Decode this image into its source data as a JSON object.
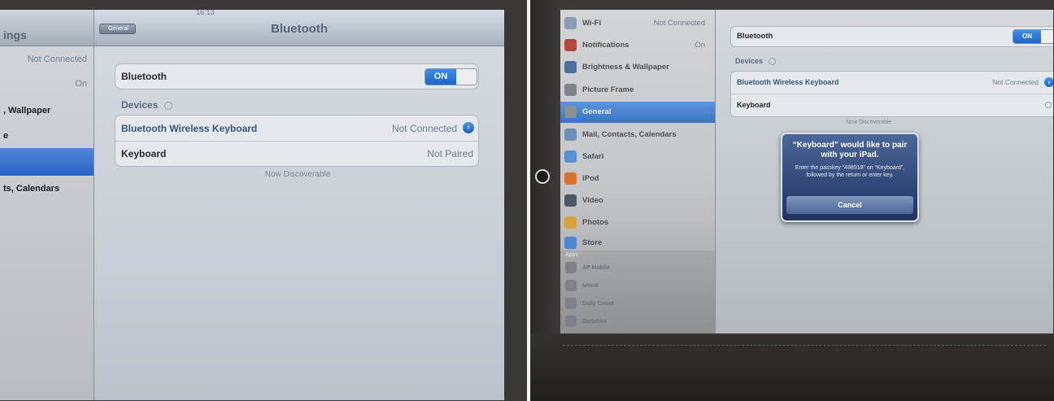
{
  "left_photo": {
    "status_bar": {
      "time": "16:13"
    },
    "sidebar": {
      "title": "ings",
      "items": [
        {
          "label": "",
          "value": "Not Connected"
        },
        {
          "label": "",
          "value": "On"
        },
        {
          "label": ", Wallpaper",
          "value": ""
        },
        {
          "label": "e",
          "value": ""
        },
        {
          "label": "",
          "value": "",
          "selected": true
        },
        {
          "label": "ts, Calendars",
          "value": ""
        }
      ]
    },
    "navbar": {
      "back_label": "General",
      "title": "Bluetooth"
    },
    "bluetooth": {
      "label": "Bluetooth",
      "toggle": "ON"
    },
    "devices_header": "Devices",
    "devices": [
      {
        "name": "Bluetooth Wireless Keyboard",
        "status": "Not Connected"
      },
      {
        "name": "Keyboard",
        "status": "Not Paired"
      }
    ],
    "discoverable": "Now Discoverable"
  },
  "right_photo": {
    "sidebar": {
      "items": [
        {
          "label": "Wi-Fi",
          "value": "Not Connected",
          "icon": "wifi-icon",
          "color": "#8a9cb4"
        },
        {
          "label": "Notifications",
          "value": "On",
          "icon": "notifications-icon",
          "color": "#b5473c"
        },
        {
          "label": "Brightness & Wallpaper",
          "value": "",
          "icon": "brightness-icon",
          "color": "#4d6e9b"
        },
        {
          "label": "Picture Frame",
          "value": "",
          "icon": "picture-frame-icon",
          "color": "#7e848c"
        },
        {
          "label": "General",
          "value": "",
          "icon": "gear-icon",
          "color": "#8b9096",
          "selected": true
        },
        {
          "label": "Mail, Contacts, Calendars",
          "value": "",
          "icon": "mail-icon",
          "color": "#6f8fb8"
        },
        {
          "label": "Safari",
          "value": "",
          "icon": "safari-icon",
          "color": "#5a8fd1"
        },
        {
          "label": "iPod",
          "value": "",
          "icon": "ipod-icon",
          "color": "#d9722c"
        },
        {
          "label": "Video",
          "value": "",
          "icon": "video-icon",
          "color": "#4e5865"
        },
        {
          "label": "Photos",
          "value": "",
          "icon": "photos-icon",
          "color": "#d9a33a"
        },
        {
          "label": "Store",
          "value": "",
          "icon": "store-icon",
          "color": "#4f86cf"
        }
      ],
      "apps_header": "Apps",
      "apps": [
        "AP Mobile",
        "Ivocal",
        "Daily Count",
        "Dictation"
      ]
    },
    "bluetooth": {
      "label": "Bluetooth",
      "toggle": "ON"
    },
    "devices_header": "Devices",
    "devices": [
      {
        "name": "Bluetooth Wireless Keyboard",
        "status": "Not Connected"
      },
      {
        "name": "Keyboard",
        "status": ""
      }
    ],
    "discoverable": "Now Discoverable",
    "alert": {
      "title": "“Keyboard” would like to pair with your iPad.",
      "message": "Enter the passkey “498918” on “Keyboard”, followed by the return or enter key.",
      "cancel_label": "Cancel"
    }
  }
}
